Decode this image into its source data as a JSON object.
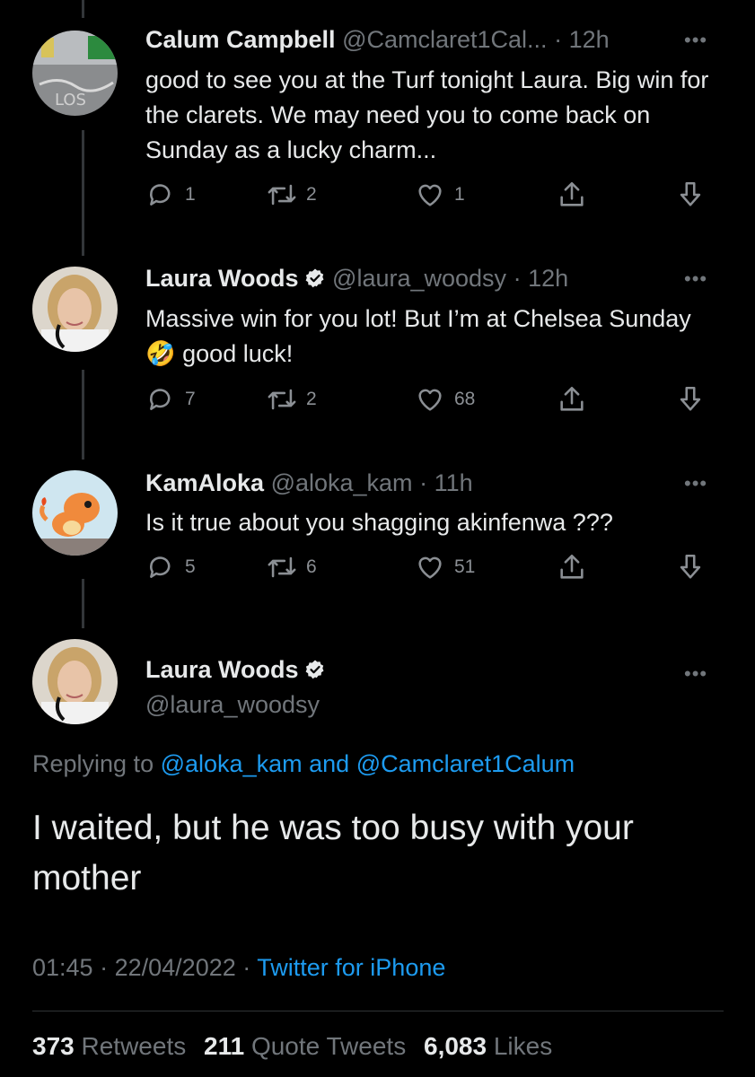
{
  "tweets": [
    {
      "name": "Calum Campbell",
      "handle": "@Camclaret1Cal...",
      "time": "12h",
      "text": "good to see you at the Turf tonight Laura. Big win for the clarets. We may need you to come back on Sunday as a lucky charm...",
      "replies": "1",
      "retweets": "2",
      "likes": "1",
      "verified": false
    },
    {
      "name": "Laura Woods",
      "handle": "@laura_woodsy",
      "time": "12h",
      "text_before_emoji": "Massive win for you lot! But I’m at Chelsea Sunday",
      "emoji": "🤣",
      "text_after_emoji": "good luck!",
      "replies": "7",
      "retweets": "2",
      "likes": "68",
      "verified": true
    },
    {
      "name": "KamAloka",
      "handle": "@aloka_kam",
      "time": "11h",
      "text": "Is it true about you shagging akinfenwa ???",
      "replies": "5",
      "retweets": "6",
      "likes": "51",
      "verified": false
    }
  ],
  "main": {
    "name": "Laura Woods",
    "handle": "@laura_woodsy",
    "replying_prefix": "Replying to",
    "replying_mention_1": "@aloka_kam",
    "replying_and": "and",
    "replying_mention_2": "@Camclaret1Calum",
    "text": "I waited, but he was too busy with your mother",
    "time": "01:45",
    "date": "22/04/2022",
    "source": "Twitter for iPhone",
    "retweets_count": "373",
    "retweets_label": "Retweets",
    "quotes_count": "211",
    "quotes_label": "Quote Tweets",
    "likes_count": "6,083",
    "likes_label": "Likes"
  },
  "separators": {
    "dot": "·",
    "more": "•••"
  },
  "colors": {
    "background": "#000000",
    "text": "#e7e9ea",
    "muted": "#71767b",
    "link": "#1d9bf0",
    "verified": "#e7e9ea"
  },
  "icons": [
    "reply-icon",
    "retweet-icon",
    "like-icon",
    "share-icon",
    "download-icon",
    "verified-icon",
    "more-icon"
  ]
}
